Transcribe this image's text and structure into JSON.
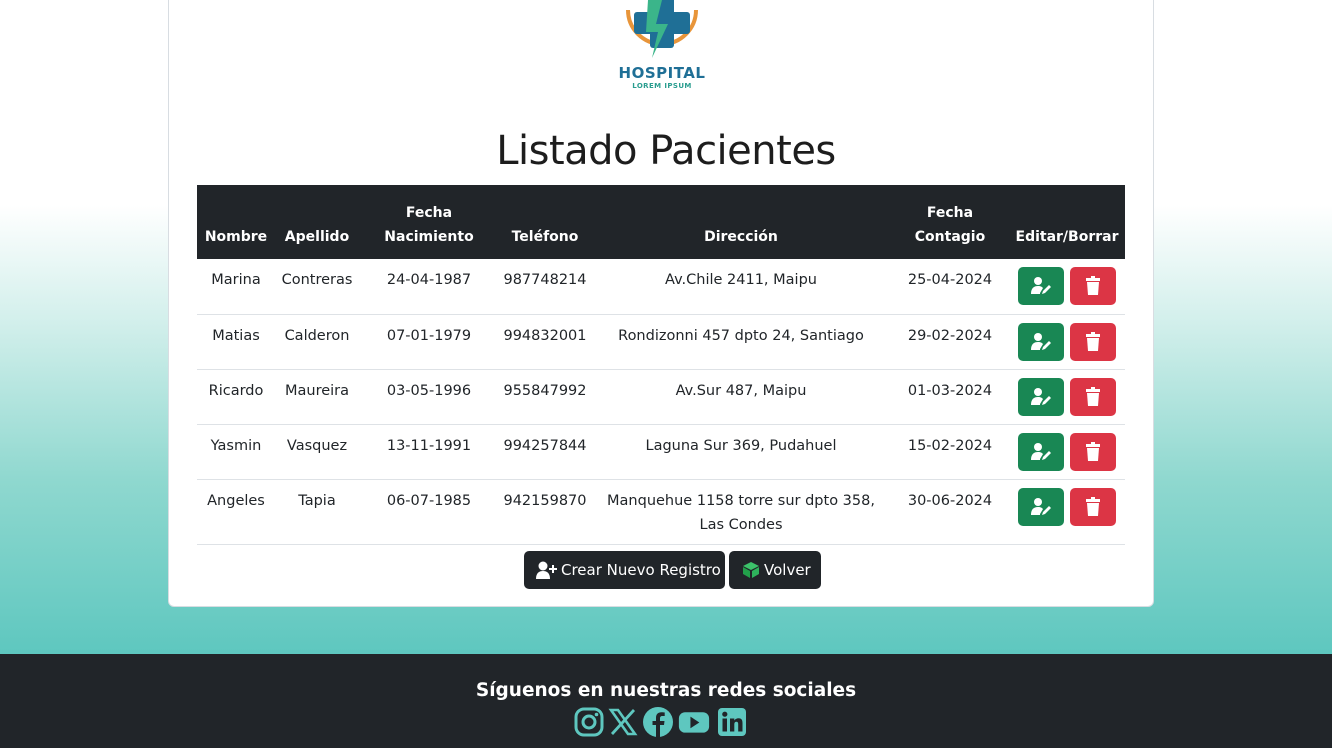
{
  "brand": {
    "name": "HOSPITAL",
    "tagline": "LOREM IPSUM"
  },
  "page_title": "Listado Pacientes",
  "table": {
    "headers": {
      "nombre": "Nombre",
      "apellido": "Apellido",
      "fecha_nacimiento_1": "Fecha",
      "fecha_nacimiento_2": "Nacimiento",
      "telefono": "Teléfono",
      "direccion": "Dirección",
      "fecha_contagio_1": "Fecha",
      "fecha_contagio_2": "Contagio",
      "acciones": "Editar/Borrar"
    },
    "rows": [
      {
        "nombre": "Marina",
        "apellido": "Contreras",
        "nacimiento": "24-04-1987",
        "telefono": "987748214",
        "direccion": "Av.Chile 2411, Maipu",
        "contagio": "25-04-2024"
      },
      {
        "nombre": "Matias",
        "apellido": "Calderon",
        "nacimiento": "07-01-1979",
        "telefono": "994832001",
        "direccion": "Rondizonni 457 dpto 24, Santiago",
        "contagio": "29-02-2024"
      },
      {
        "nombre": "Ricardo",
        "apellido": "Maureira",
        "nacimiento": "03-05-1996",
        "telefono": "955847992",
        "direccion": "Av.Sur 487, Maipu",
        "contagio": "01-03-2024"
      },
      {
        "nombre": "Yasmin",
        "apellido": "Vasquez",
        "nacimiento": "13-11-1991",
        "telefono": "994257844",
        "direccion": "Laguna Sur 369, Pudahuel",
        "contagio": "15-02-2024"
      },
      {
        "nombre": "Angeles",
        "apellido": "Tapia",
        "nacimiento": "06-07-1985",
        "telefono": "942159870",
        "direccion": "Manquehue 1158 torre sur dpto 358, Las Condes",
        "contagio": "30-06-2024"
      }
    ]
  },
  "actions": {
    "create_label": "Crear Nuevo Registro",
    "back_label": "Volver"
  },
  "footer": {
    "title": "Síguenos en nuestras redes sociales",
    "social_icons": [
      "instagram-icon",
      "x-icon",
      "facebook-icon",
      "youtube-icon",
      "linkedin-icon"
    ]
  },
  "colors": {
    "edit": "#198754",
    "delete": "#dc3545",
    "dark": "#212529",
    "social": "#5ec7bf"
  }
}
